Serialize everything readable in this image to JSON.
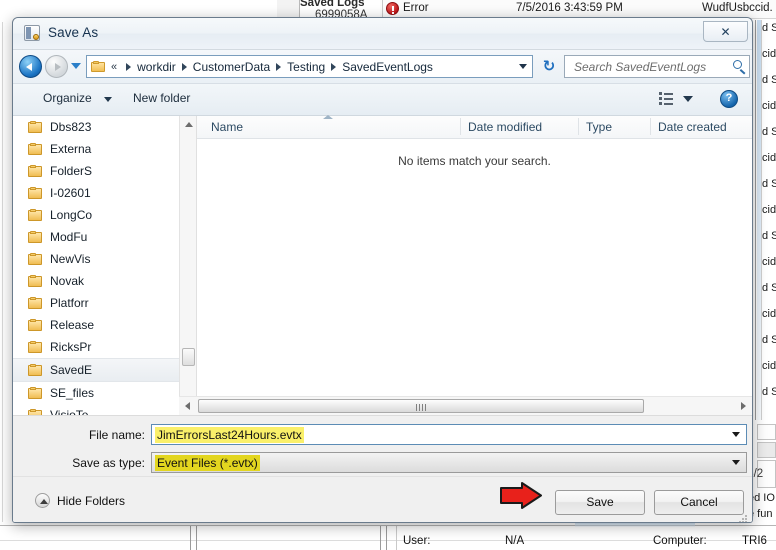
{
  "dialog": {
    "title": "Save As",
    "title_icon": "event-log-file-icon",
    "close_label": "✕",
    "nav": {
      "back_icon": "back-arrow-icon",
      "forward_icon": "forward-arrow-icon",
      "recent_dropdown_icon": "chevron-down-icon",
      "folder_icon": "folder-icon",
      "overflow_label": "«",
      "breadcrumbs": [
        "workdir",
        "CustomerData",
        "Testing",
        "SavedEventLogs"
      ],
      "address_dropdown_icon": "chevron-down-icon",
      "refresh_icon": "refresh-icon",
      "refresh_label": "↻"
    },
    "search": {
      "placeholder": "Search SavedEventLogs",
      "value": "",
      "icon": "search-icon"
    },
    "commandbar": {
      "organize_label": "Organize",
      "organize_caret_icon": "chevron-down-icon",
      "new_folder_label": "New folder",
      "view_icon": "view-layout-icon",
      "view_caret_icon": "chevron-down-icon",
      "help_icon": "help-icon",
      "help_label": "?"
    },
    "navpane": {
      "folders": [
        {
          "label": "Dbs823",
          "selected": false
        },
        {
          "label": "Externa",
          "selected": false
        },
        {
          "label": "FolderS",
          "selected": false
        },
        {
          "label": "I-02601",
          "selected": false
        },
        {
          "label": "LongCo",
          "selected": false
        },
        {
          "label": "ModFu",
          "selected": false
        },
        {
          "label": "NewVis",
          "selected": false
        },
        {
          "label": "Novak",
          "selected": false
        },
        {
          "label": "Platforr",
          "selected": false
        },
        {
          "label": "Release",
          "selected": false
        },
        {
          "label": "RicksPr",
          "selected": false
        },
        {
          "label": "SavedE",
          "selected": true
        },
        {
          "label": "SE_files",
          "selected": false
        },
        {
          "label": "VisioTe",
          "selected": false
        }
      ],
      "scroll_up_icon": "scroll-up-arrow-icon",
      "scroll_down_icon": "scroll-down-arrow-icon"
    },
    "filelist": {
      "columns": [
        "Name",
        "Date modified",
        "Type",
        "Date created"
      ],
      "sort_indicator_icon": "sort-ascending-icon",
      "empty_message": "No items match your search.",
      "rows": [],
      "hscroll_left_icon": "scroll-left-arrow-icon",
      "hscroll_right_icon": "scroll-right-arrow-icon"
    },
    "fields": {
      "filename_label": "File name:",
      "filename_value": "JimErrorsLast24Hours.evtx",
      "filename_dropdown_icon": "chevron-down-icon",
      "savetype_label": "Save as type:",
      "savetype_value": "Event Files (*.evtx)",
      "savetype_dropdown_icon": "chevron-down-icon"
    },
    "footer": {
      "hide_folders_label": "Hide Folders",
      "hide_folders_icon": "collapse-up-icon",
      "pointer_icon": "red-arrow-annotation",
      "save_label": "Save",
      "cancel_label": "Cancel",
      "resize_grip_icon": "resize-grip-icon"
    }
  },
  "background": {
    "tree": {
      "saved_logs_label": "Saved Logs",
      "node_label": "6999058A"
    },
    "event_row": {
      "level_icon": "error-icon",
      "level": "Error",
      "datetime": "7/5/2016 3:43:59 PM",
      "source": "WudfUsbccid."
    },
    "right_fragments": [
      "d S..",
      "cid.",
      "d S..",
      "cid.",
      "d S..",
      "cid.",
      "d S..",
      "cid.",
      "d S..",
      "cid.",
      "d S..",
      "cid.",
      "d S..",
      "cid.",
      "d S.."
    ],
    "detail_fragments": [
      "ed IO",
      "e fun"
    ],
    "date_fragment": "/5/2",
    "status": {
      "user_label": "User:",
      "user_value": "N/A",
      "computer_label": "Computer:",
      "computer_value": "TRI6"
    }
  },
  "colors": {
    "highlight_filename": "#faf06a",
    "highlight_savetype": "#e3d61f",
    "annotation_arrow": "#e8211b",
    "error_icon": "#c0161a",
    "title_text": "#16324f"
  }
}
